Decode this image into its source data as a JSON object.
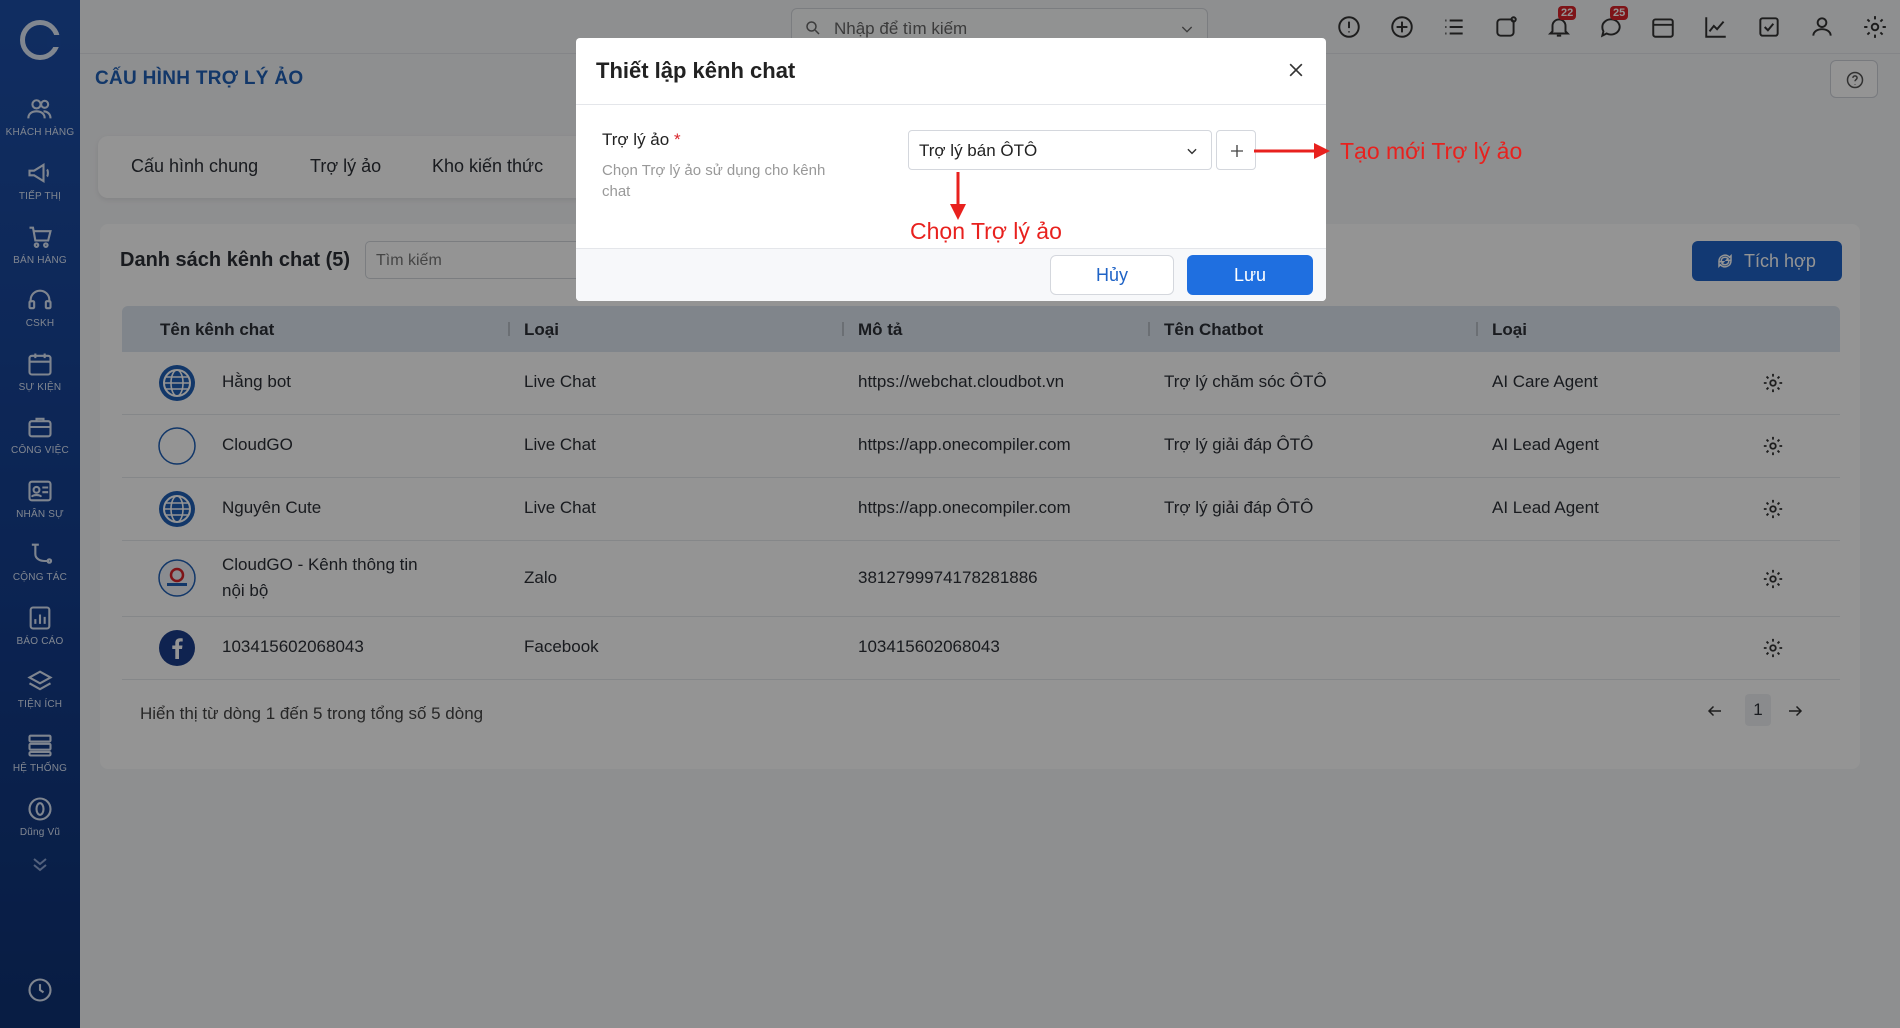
{
  "sidebar": {
    "items": [
      {
        "label": "KHÁCH HÀNG",
        "icon": "users-icon"
      },
      {
        "label": "TIẾP THỊ",
        "icon": "megaphone-icon"
      },
      {
        "label": "BÁN HÀNG",
        "icon": "cart-icon"
      },
      {
        "label": "CSKH",
        "icon": "headset-icon"
      },
      {
        "label": "SỰ KIỆN",
        "icon": "calendar-icon"
      },
      {
        "label": "CÔNG VIỆC",
        "icon": "briefcase-icon"
      },
      {
        "label": "NHÂN SỰ",
        "icon": "id-card-icon"
      },
      {
        "label": "CỘNG TÁC",
        "icon": "collaboration-icon"
      },
      {
        "label": "BÁO CÁO",
        "icon": "report-icon"
      },
      {
        "label": "TIỆN ÍCH",
        "icon": "layers-icon"
      },
      {
        "label": "HỆ THỐNG",
        "icon": "server-icon"
      },
      {
        "label": "Dũng Vũ",
        "icon": "user-zero-icon"
      }
    ]
  },
  "topbar": {
    "search_placeholder": "Nhập để tìm kiếm",
    "notifications_badge": "22",
    "messages_badge": "25"
  },
  "page": {
    "title": "CẤU HÌNH TRỢ LÝ ẢO"
  },
  "tabs": [
    "Cấu hình chung",
    "Trợ lý ảo",
    "Kho kiến thức"
  ],
  "list": {
    "title": "Danh sách kênh chat (5)",
    "search_placeholder": "Tìm kiếm",
    "integrate_label": "Tích hợp",
    "columns": [
      "Tên kênh chat",
      "Loại",
      "Mô tả",
      "Tên Chatbot",
      "Loại"
    ],
    "rows": [
      {
        "name": "Hằng bot",
        "type": "Live Chat",
        "desc": "https://webchat.cloudbot.vn",
        "chatbot": "Trợ lý chăm sóc ÔTÔ",
        "agent": "AI Care Agent",
        "icon": "globe-icon"
      },
      {
        "name": "CloudGO",
        "type": "Live Chat",
        "desc": "https://app.onecompiler.com",
        "chatbot": "Trợ lý giải đáp ÔTÔ",
        "agent": "AI Lead Agent",
        "icon": "empty-circle-icon"
      },
      {
        "name": "Nguyên Cute",
        "type": "Live Chat",
        "desc": "https://app.onecompiler.com",
        "chatbot": "Trợ lý giải đáp ÔTÔ",
        "agent": "AI Lead Agent",
        "icon": "globe-icon"
      },
      {
        "name": "CloudGO - Kênh thông tin",
        "name2": "nội bộ",
        "type": "Zalo",
        "desc": "3812799974178281886",
        "chatbot": "",
        "agent": "",
        "icon": "cloudgo-logo-icon"
      },
      {
        "name": "103415602068043",
        "type": "Facebook",
        "desc": "103415602068043",
        "chatbot": "",
        "agent": "",
        "icon": "facebook-icon"
      }
    ],
    "footer": "Hiển thị từ dòng 1 đến 5 trong tổng số 5 dòng",
    "page": "1"
  },
  "modal": {
    "title": "Thiết lập kênh chat",
    "field_label": "Trợ lý ảo",
    "required_mark": "*",
    "field_help": "Chọn Trợ lý ảo sử dụng cho kênh chat",
    "selected_value": "Trợ lý bán ÔTÔ",
    "cancel_label": "Hủy",
    "save_label": "Lưu"
  },
  "annotations": {
    "create_new": "Tạo mới Trợ lý ảo",
    "choose": "Chọn Trợ lý ảo",
    "color": "#e8211e"
  },
  "colors": {
    "primary": "#1f63c6",
    "sidebar": "#1d4fa8",
    "badge": "#d9242a"
  }
}
